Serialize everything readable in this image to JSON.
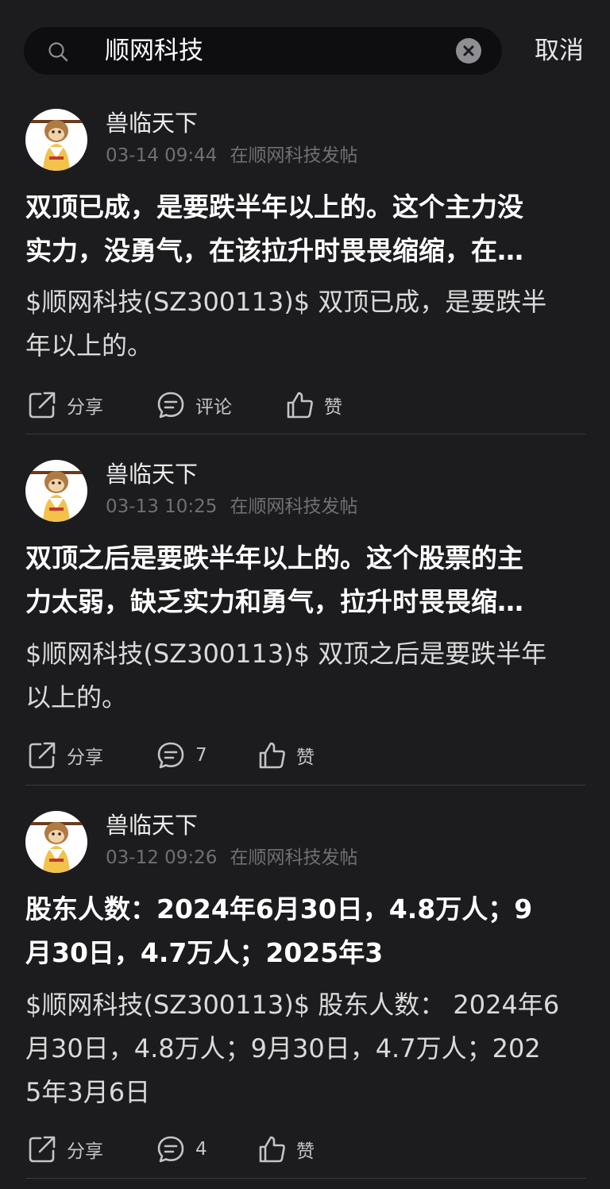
{
  "search": {
    "query": "顺网科技",
    "cancel_label": "取消"
  },
  "posts": [
    {
      "author": "兽临天下",
      "time": "03-14 09:44",
      "location": "在顺网科技发帖",
      "title_line1": "双顶已成，是要跌半年以上的。这个主力没",
      "title_line2": "实力，没勇气，在该拉升时畏畏缩缩，在…",
      "body_line1": "$顺网科技(SZ300113)$ 双顶已成，是要跌半",
      "body_line2": "年以上的。",
      "share_label": "分享",
      "comment_label": "评论",
      "like_label": "赞"
    },
    {
      "author": "兽临天下",
      "time": "03-13 10:25",
      "location": "在顺网科技发帖",
      "title_line1": "双顶之后是要跌半年以上的。这个股票的主",
      "title_line2": "力太弱，缺乏实力和勇气，拉升时畏畏缩…",
      "body_line1": "$顺网科技(SZ300113)$ 双顶之后是要跌半年",
      "body_line2": "以上的。",
      "share_label": "分享",
      "comment_label": "7",
      "like_label": "赞"
    },
    {
      "author": "兽临天下",
      "time": "03-12 09:26",
      "location": "在顺网科技发帖",
      "title_line1": "股东人数：2024年6月30日，4.8万人；9",
      "title_line2": "月30日，4.7万人；2025年3",
      "body_line1": "$顺网科技(SZ300113)$ 股东人数： 2024年6",
      "body_line2": "月30日，4.8万人；9月30日，4.7万人；202",
      "body_line3": "5年3月6日",
      "share_label": "分享",
      "comment_label": "4",
      "like_label": "赞"
    }
  ],
  "icons": {
    "search": "search-icon",
    "clear": "clear-icon",
    "avatar": "monkey-king-avatar",
    "share": "share-icon",
    "comment": "comment-icon",
    "like": "thumbs-up-icon"
  }
}
